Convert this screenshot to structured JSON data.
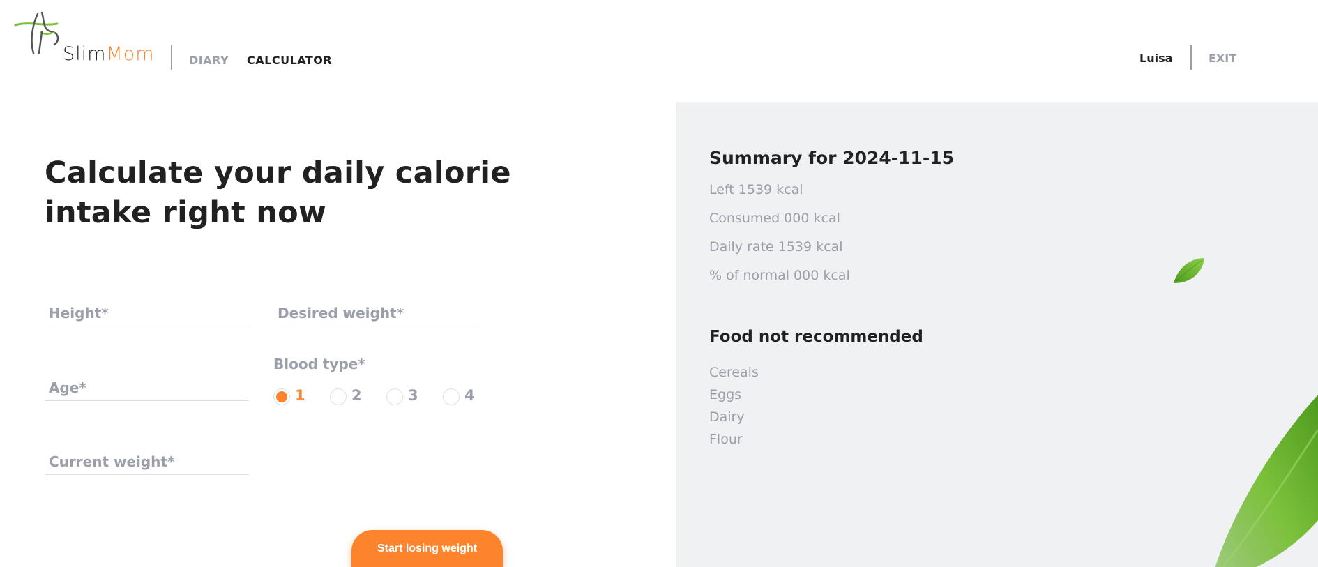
{
  "header": {
    "logo": {
      "name_part1": "Slim",
      "name_part2": "Mom",
      "accent_color": "#FC842D",
      "leaf_color": "#7CC13B"
    },
    "nav": [
      {
        "label": "DIARY",
        "active": false
      },
      {
        "label": "CALCULATOR",
        "active": true
      }
    ],
    "user_name": "Luisa",
    "exit_label": "EXIT"
  },
  "form": {
    "title": "Calculate your daily calorie intake right now",
    "fields": {
      "height": {
        "placeholder": "Height*",
        "value": ""
      },
      "desired_weight": {
        "placeholder": "Desired weight*",
        "value": ""
      },
      "age": {
        "placeholder": "Age*",
        "value": ""
      },
      "current_weight": {
        "placeholder": "Current weight*",
        "value": ""
      }
    },
    "blood_type": {
      "label": "Blood type*",
      "options": [
        "1",
        "2",
        "3",
        "4"
      ],
      "selected": "1"
    },
    "submit_label": "Start losing weight"
  },
  "summary": {
    "title": "Summary for 2024-11-15",
    "left": "Left 1539 kcal",
    "consumed": "Consumed 000 kcal",
    "daily_rate": "Daily rate 1539 kcal",
    "percent_of_normal": "% of normal 000 kcal"
  },
  "food_not_recommended": {
    "title": "Food not recommended",
    "items": [
      "Cereals",
      "Eggs",
      "Dairy",
      "Flour"
    ]
  },
  "colors": {
    "accent": "#FC842D",
    "text_primary": "#212121",
    "text_secondary": "#9B9FAA",
    "panel_bg": "#F0F1F3",
    "leaf_green": "#7CC13B"
  },
  "icons": [
    "logo-leaf-icon",
    "radio-selected-icon",
    "radio-empty-icon",
    "decorative-leaf-icon"
  ]
}
